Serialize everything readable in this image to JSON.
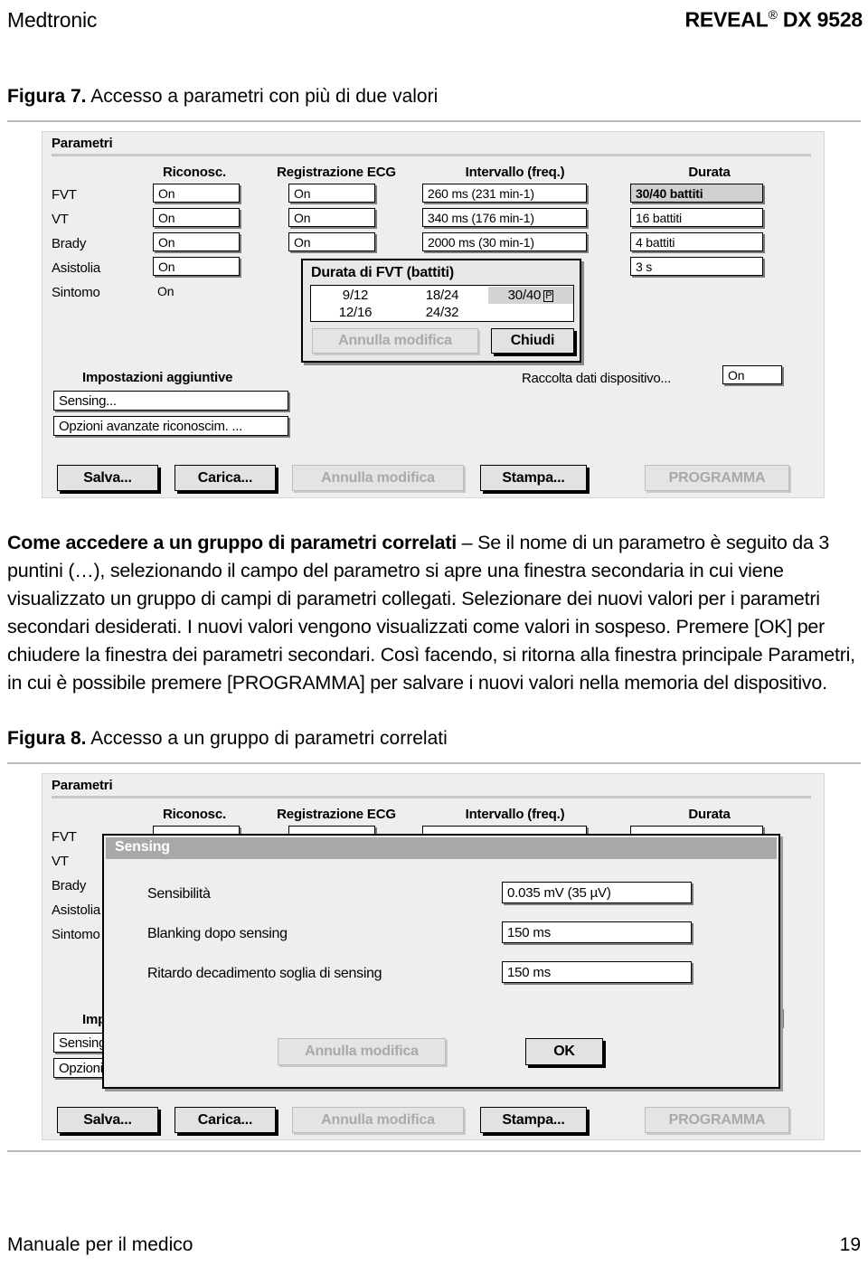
{
  "header": {
    "left": "Medtronic",
    "product": "REVEAL",
    "registered": "®",
    "model": "DX 9528"
  },
  "footer": {
    "left": "Manuale per il medico",
    "page": "19"
  },
  "figure7": {
    "caption_label": "Figura 7.",
    "caption_text": "Accesso a parametri con più di due valori",
    "window_title": "Parametri",
    "columns": [
      "Riconosc.",
      "Registrazione ECG",
      "Intervallo (freq.)",
      "Durata"
    ],
    "rows": [
      {
        "label": "FVT",
        "riconosc": "On",
        "ecg": "On",
        "intervallo": "260 ms (231 min-1)",
        "durata": "30/40 battiti"
      },
      {
        "label": "VT",
        "riconosc": "On",
        "ecg": "On",
        "intervallo": "340 ms (176 min-1)",
        "durata": "16 battiti"
      },
      {
        "label": "Brady",
        "riconosc": "On",
        "ecg": "On",
        "intervallo": "2000 ms (30 min-1)",
        "durata": "4 battiti"
      },
      {
        "label": "Asistolia",
        "riconosc": "On",
        "ecg": "",
        "intervallo": "",
        "durata": "3 s"
      },
      {
        "label": "Sintomo",
        "riconosc": "On",
        "ecg": "",
        "intervallo": "",
        "durata": ""
      }
    ],
    "additional_settings_heading": "Impostazioni aggiuntive",
    "additional_settings": [
      "Sensing...",
      "Opzioni avanzate riconoscim. ..."
    ],
    "device_data_label": "Raccolta dati dispositivo...",
    "device_data_value": "On",
    "toolbar": {
      "save": "Salva...",
      "load": "Carica...",
      "undo": "Annulla modifica",
      "print": "Stampa...",
      "program": "PROGRAMMA"
    },
    "popup": {
      "title": "Durata di FVT (battiti)",
      "options": [
        "9/12",
        "18/24",
        "30/40",
        "12/16",
        "24/32"
      ],
      "selected": "30/40",
      "pending_marker": "P",
      "undo": "Annulla modifica",
      "close": "Chiudi"
    }
  },
  "body_text": {
    "lead": "Come accedere a un gruppo di parametri correlati",
    "rest": " – Se il nome di un parametro è seguito da 3 puntini (…), selezionando il campo del parametro si apre una finestra secondaria in cui viene visualizzato un gruppo di campi di parametri collegati. Selezionare dei nuovi valori per i parametri secondari desiderati. I nuovi valori vengono visualizzati come valori in sospeso. Premere [OK] per chiudere la finestra dei parametri secondari. Così facendo, si ritorna alla finestra principale Parametri, in cui è possibile premere [PROGRAMMA] per salvare i nuovi valori nella memoria del dispositivo."
  },
  "figure8": {
    "caption_label": "Figura 8.",
    "caption_text": "Accesso a un gruppo di parametri correlati",
    "window_title": "Parametri",
    "columns": [
      "Riconosc.",
      "Registrazione ECG",
      "Intervallo (freq.)",
      "Durata"
    ],
    "row_labels": [
      "FVT",
      "VT",
      "Brady",
      "Asistolia",
      "Sintomo"
    ],
    "additional_settings_heading": "Impostazioni aggiuntive",
    "additional_settings": [
      "Sensing...",
      "Opzioni avanzate riconoscim. ..."
    ],
    "toolbar": {
      "save": "Salva...",
      "load": "Carica...",
      "undo": "Annulla modifica",
      "print": "Stampa...",
      "program": "PROGRAMMA"
    },
    "modal": {
      "title": "Sensing",
      "fields": [
        {
          "label": "Sensibilità",
          "value": "0.035 mV (35 µV)"
        },
        {
          "label": "Blanking dopo sensing",
          "value": "150 ms"
        },
        {
          "label": "Ritardo decadimento soglia di sensing",
          "value": "150 ms"
        }
      ],
      "undo": "Annulla modifica",
      "ok": "OK"
    }
  },
  "colors": {
    "window_bg": "#eeeeee",
    "field_bg": "#ffffff",
    "selected_field_bg": "#d0d0d0",
    "titlebar_bg": "#a8a8a8",
    "button_bg": "#e2e2e2",
    "disabled_text": "#a9a9a9"
  }
}
